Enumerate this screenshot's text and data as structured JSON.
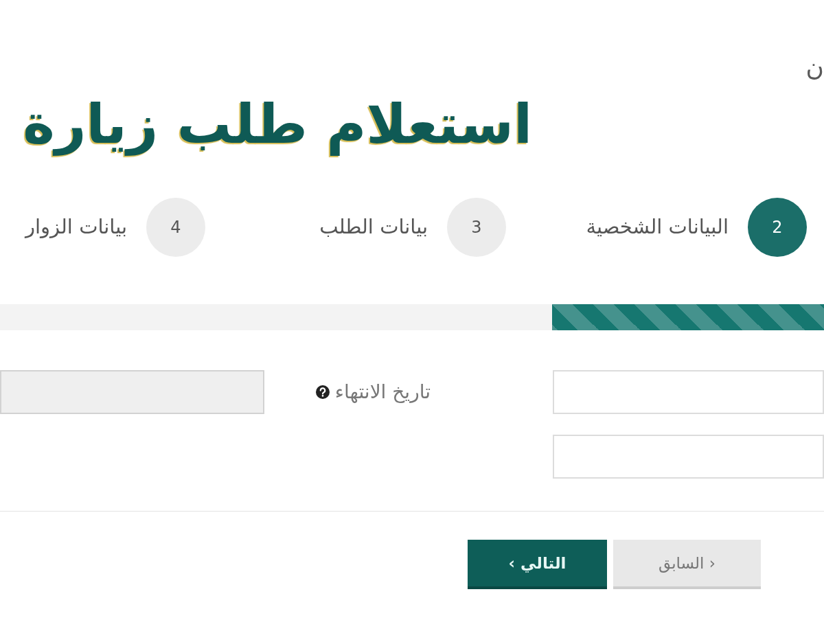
{
  "header": {
    "text": "ن"
  },
  "title": "استعلام طلب زيارة",
  "steps": [
    {
      "number": "2",
      "label": "البيانات الشخصية",
      "selected": true
    },
    {
      "number": "3",
      "label": "بيانات الطلب",
      "selected": false
    },
    {
      "number": "4",
      "label": "بيانات الزوار",
      "selected": false
    }
  ],
  "progress": {
    "level": 0.33
  },
  "form": {
    "rows": [
      {
        "cells": [
          {
            "kind": "input",
            "disabled": false
          },
          {
            "kind": "label",
            "label": "تاريخ الانتهاء",
            "help": true
          },
          {
            "kind": "input",
            "disabled": true
          }
        ]
      },
      {
        "cells": [
          {
            "kind": "input",
            "disabled": false
          }
        ]
      }
    ]
  },
  "buttons": [
    {
      "kind": "secondary",
      "label": "‹ السابق"
    },
    {
      "kind": "primary",
      "label": "التالي ›"
    }
  ]
}
